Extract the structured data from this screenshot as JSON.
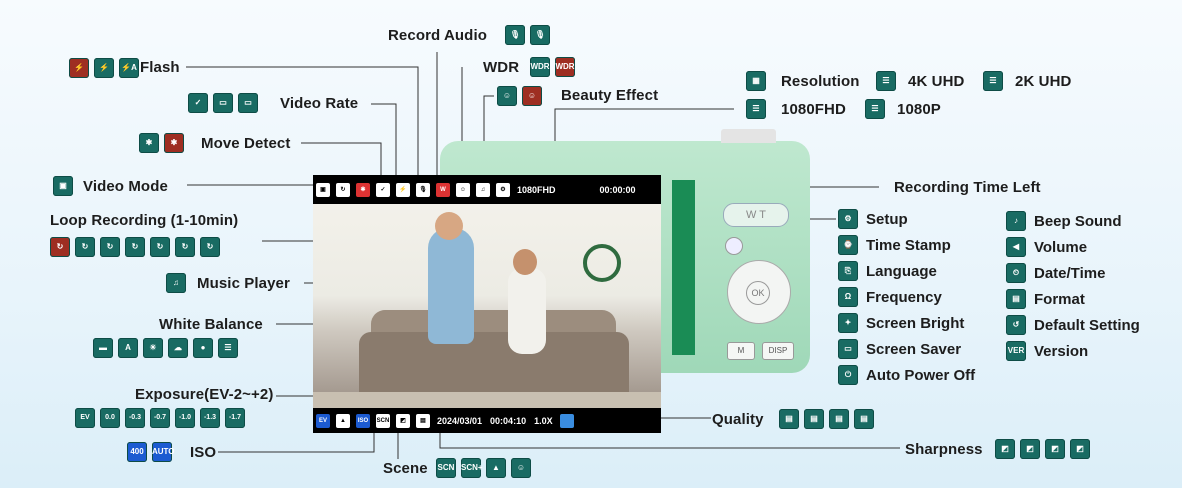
{
  "labels": {
    "record_audio": "Record Audio",
    "flash": "Flash",
    "wdr": "WDR",
    "beauty_effect": "Beauty Effect",
    "video_rate": "Video Rate",
    "resolution": "Resolution",
    "res_4k": "4K UHD",
    "res_2k": "2K UHD",
    "res_1080fhd": "1080FHD",
    "res_1080p": "1080P",
    "move_detect": "Move Detect",
    "video_mode": "Video Mode",
    "recording_time_left": "Recording Time Left",
    "loop_recording": "Loop Recording (1-10min)",
    "music_player": "Music Player",
    "white_balance": "White Balance",
    "exposure": "Exposure(EV-2~+2)",
    "iso": "ISO",
    "scene": "Scene",
    "quality": "Quality",
    "sharpness": "Sharpness"
  },
  "settings_left": [
    "Setup",
    "Time Stamp",
    "Language",
    "Frequency",
    "Screen Bright",
    "Screen Saver",
    "Auto Power Off"
  ],
  "settings_right": [
    "Beep Sound",
    "Volume",
    "Date/Time",
    "Format",
    "Default Setting",
    "Version"
  ],
  "screen": {
    "top_res": "1080FHD",
    "top_time": "00:00:00",
    "bottom_ev": "EV",
    "bottom_ev_val": "0.0",
    "bottom_iso": "ISO",
    "bottom_iso_val": "AUTO",
    "bottom_scene": "SCN",
    "bottom_date": "2024/03/01",
    "bottom_time": "00:04:10",
    "bottom_zoom": "1.0X"
  },
  "camera": {
    "zoom_label": "W  T",
    "ok": "OK",
    "menu": "M",
    "disp": "DISP"
  },
  "icon_text": {
    "ev_values": [
      "EV",
      "0.0",
      "-0.3",
      "-0.7",
      "-1.0",
      "-1.3",
      "-1.7"
    ],
    "iso_values": [
      "400",
      "AUTO"
    ],
    "wdr": "WDR",
    "scene": [
      "SCN",
      "SCN+"
    ],
    "ver": "VER"
  },
  "colors": {
    "icon_teal": "#196b63",
    "icon_red": "#9e2e22",
    "camera_body": "#a8dcc0"
  }
}
